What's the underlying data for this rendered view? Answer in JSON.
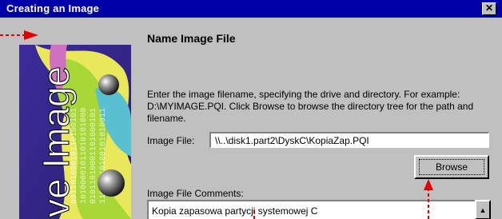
{
  "window": {
    "title": "Creating an Image",
    "close_glyph": "✕"
  },
  "page": {
    "heading": "Name Image File",
    "instructions": [
      "Enter the image filename, specifying the drive and directory.  For example:",
      "D:\\MYIMAGE.PQI.  Click Browse to browse the directory tree for the path and",
      "filename."
    ],
    "file_label": "Image File:",
    "file_value": "\\\\..\\disk1.part2\\DyskC\\KopiaZap.PQI",
    "browse_label": "Browse",
    "comments_label": "Image File Comments:",
    "comments_value": "Kopia zapasowa partycji systemowej C"
  },
  "art": {
    "text": "ve Image"
  },
  "colors": {
    "titlebar": "#0000a8",
    "dialog": "#c0c0c0",
    "annotation": "#e00000"
  }
}
